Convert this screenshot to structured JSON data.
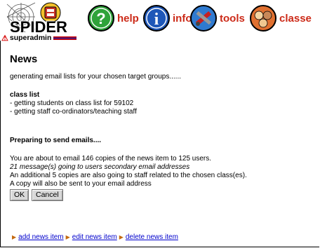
{
  "app": {
    "logo_text": "SPIDER"
  },
  "nav": {
    "items": [
      {
        "label": "help",
        "icon": "help-icon"
      },
      {
        "label": "info",
        "icon": "info-icon"
      },
      {
        "label": "tools",
        "icon": "tools-icon"
      },
      {
        "label": "classe",
        "icon": "classes-icon"
      }
    ]
  },
  "user": {
    "name": "superadmin"
  },
  "page": {
    "title": "News",
    "intro": "generating email lists for your chosen target groups......",
    "class_list_heading": "class list",
    "class_list_lines": [
      " - getting students on class list for 59102",
      " - getting staff co-ordinators/teaching staff"
    ],
    "preparing": "Preparing to send emails....",
    "summary_lines": [
      "You are about to email 146 copies of the news item to 125 users.",
      "21 message(s) going to users secondary email addresses",
      "An additional 5 copies are also going to staff related to the chosen class(es).",
      "A copy will also be sent to your email address"
    ],
    "ok_label": "OK",
    "cancel_label": "Cancel"
  },
  "footer": {
    "links": [
      "add news item",
      "edit news item",
      "delete news item"
    ]
  },
  "colors": {
    "nav_label": "#cc2a18",
    "link": "#0000cc"
  }
}
